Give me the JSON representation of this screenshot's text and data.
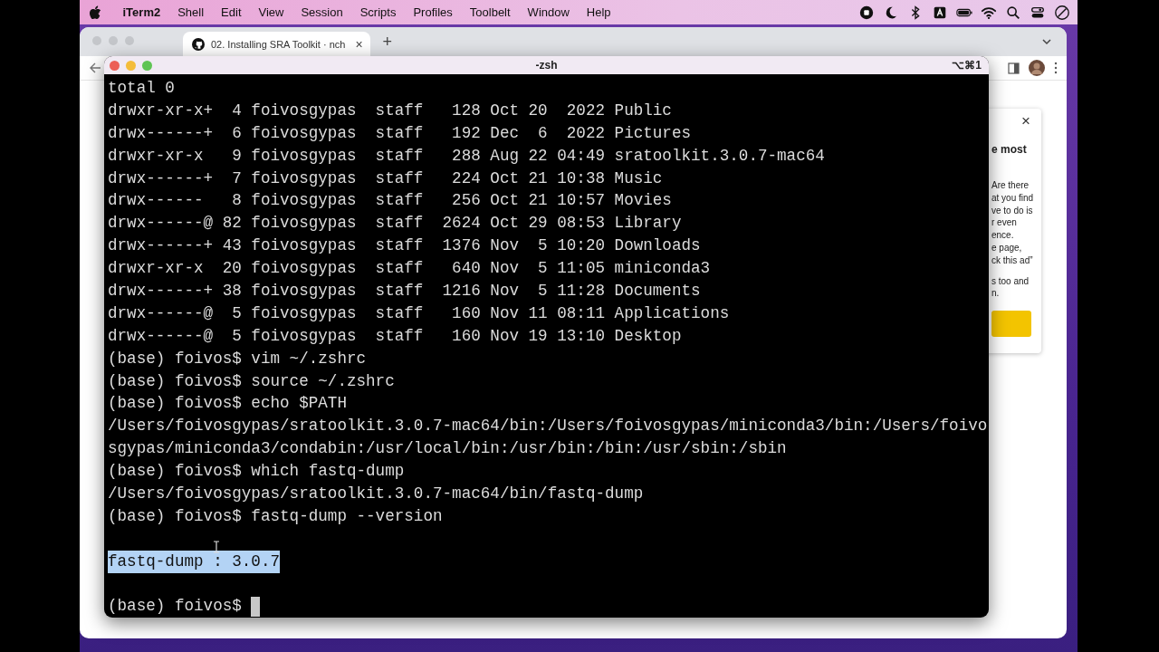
{
  "menu_bar": {
    "app": "iTerm2",
    "items": [
      "Shell",
      "Edit",
      "View",
      "Session",
      "Scripts",
      "Profiles",
      "Toolbelt",
      "Window",
      "Help"
    ]
  },
  "browser": {
    "tab": {
      "title": "02. Installing SRA Toolkit · nch",
      "selected": true,
      "close": "×"
    },
    "new_tab": "+",
    "ad_panel": {
      "close": "×",
      "title": "e most",
      "body": [
        "Are there",
        "at you find",
        "ve to do is",
        "r even",
        "ence.",
        "e page,",
        "ck this ad”"
      ],
      "body2": [
        "s too and",
        "n."
      ]
    }
  },
  "terminal": {
    "title": "-zsh",
    "shortcut": "⌥⌘1",
    "cursor": true,
    "lines": [
      {
        "kind": "text",
        "text": "total 0",
        "selected": false
      },
      {
        "kind": "text",
        "text": "drwxr-xr-x+  4 foivosgypas  staff   128 Oct 20  2022 Public",
        "selected": false
      },
      {
        "kind": "text",
        "text": "drwx------+  6 foivosgypas  staff   192 Dec  6  2022 Pictures",
        "selected": false
      },
      {
        "kind": "text",
        "text": "drwxr-xr-x   9 foivosgypas  staff   288 Aug 22 04:49 sratoolkit.3.0.7-mac64",
        "selected": false
      },
      {
        "kind": "text",
        "text": "drwx------+  7 foivosgypas  staff   224 Oct 21 10:38 Music",
        "selected": false
      },
      {
        "kind": "text",
        "text": "drwx------   8 foivosgypas  staff   256 Oct 21 10:57 Movies",
        "selected": false
      },
      {
        "kind": "text",
        "text": "drwx------@ 82 foivosgypas  staff  2624 Oct 29 08:53 Library",
        "selected": false
      },
      {
        "kind": "text",
        "text": "drwx------+ 43 foivosgypas  staff  1376 Nov  5 10:20 Downloads",
        "selected": false
      },
      {
        "kind": "text",
        "text": "drwxr-xr-x  20 foivosgypas  staff   640 Nov  5 11:05 miniconda3",
        "selected": false
      },
      {
        "kind": "text",
        "text": "drwx------+ 38 foivosgypas  staff  1216 Nov  5 11:28 Documents",
        "selected": false
      },
      {
        "kind": "text",
        "text": "drwx------@  5 foivosgypas  staff   160 Nov 11 08:11 Applications",
        "selected": false
      },
      {
        "kind": "text",
        "text": "drwx------@  5 foivosgypas  staff   160 Nov 19 13:10 Desktop",
        "selected": false
      },
      {
        "kind": "text",
        "text": "(base) foivos$ vim ~/.zshrc",
        "selected": false
      },
      {
        "kind": "text",
        "text": "(base) foivos$ source ~/.zshrc",
        "selected": false
      },
      {
        "kind": "text",
        "text": "(base) foivos$ echo $PATH",
        "selected": false
      },
      {
        "kind": "text",
        "text": "/Users/foivosgypas/sratoolkit.3.0.7-mac64/bin:/Users/foivosgypas/miniconda3/bin:/Users/foivo",
        "selected": false
      },
      {
        "kind": "text",
        "text": "sgypas/miniconda3/condabin:/usr/local/bin:/usr/bin:/bin:/usr/sbin:/sbin",
        "selected": false
      },
      {
        "kind": "text",
        "text": "(base) foivos$ which fastq-dump",
        "selected": false
      },
      {
        "kind": "text",
        "text": "/Users/foivosgypas/sratoolkit.3.0.7-mac64/bin/fastq-dump",
        "selected": false
      },
      {
        "kind": "text",
        "text": "(base) foivos$ fastq-dump --version",
        "selected": false
      },
      {
        "kind": "blank"
      },
      {
        "kind": "text",
        "text": "fastq-dump : 3.0.7",
        "selected": true
      },
      {
        "kind": "blank"
      },
      {
        "kind": "text",
        "text": "(base) foivos$",
        "selected": false
      }
    ]
  }
}
